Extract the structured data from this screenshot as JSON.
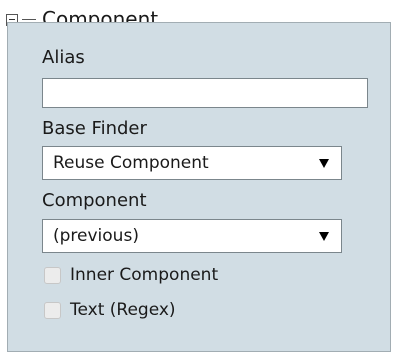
{
  "section": {
    "title": "Component",
    "collapse_icon": "minus-box-icon"
  },
  "alias": {
    "label": "Alias",
    "value": "",
    "placeholder": ""
  },
  "base_finder": {
    "label": "Base Finder",
    "selected": "Reuse Component"
  },
  "component": {
    "label": "Component",
    "selected": "(previous)"
  },
  "options": {
    "inner_component": {
      "label": "Inner Component",
      "checked": false
    },
    "text_regex": {
      "label": "Text (Regex)",
      "checked": false
    }
  },
  "colors": {
    "panel_background": "#d1dde4",
    "panel_border": "#a2adb3"
  }
}
